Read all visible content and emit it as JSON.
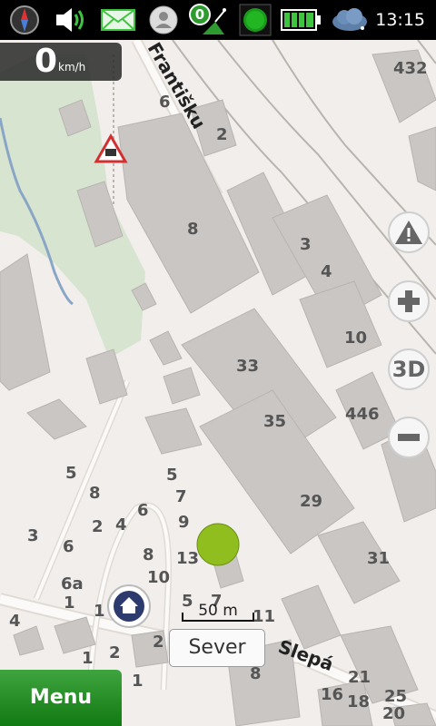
{
  "status_bar": {
    "time": "13:15",
    "notification_badge": "0",
    "icons": [
      "compass-icon",
      "speaker-icon",
      "mail-icon",
      "contact-icon",
      "gps-satellite-icon",
      "record-icon",
      "battery-icon",
      "weather-icon"
    ]
  },
  "speed": {
    "value": "0",
    "unit": "km/h"
  },
  "map": {
    "street_labels": [
      "Františku",
      "Slepá"
    ],
    "house_numbers": [
      "432",
      "6",
      "2",
      "8",
      "3",
      "4",
      "10",
      "33",
      "35",
      "446",
      "29",
      "31",
      "5",
      "8",
      "5",
      "7",
      "9",
      "2",
      "4",
      "6",
      "3",
      "6",
      "8",
      "13",
      "10",
      "6a",
      "1",
      "1",
      "4",
      "5",
      "7",
      "11",
      "1",
      "2",
      "2",
      "1",
      "8",
      "21",
      "16",
      "18",
      "25",
      "20"
    ]
  },
  "controls": {
    "warning": "warning-icon",
    "zoom_in": "plus-icon",
    "view_3d": "3D",
    "zoom_out": "minus-icon"
  },
  "scale": {
    "label": "50 m"
  },
  "current_street": "Sever",
  "menu_label": "Menu",
  "colors": {
    "map_background": "#f1eeec",
    "building": "#c9c6c3",
    "park": "#d7e5d0",
    "water": "#8aa6c6",
    "position_marker": "#8fbe1e",
    "menu_button": "#2a8f2a"
  }
}
